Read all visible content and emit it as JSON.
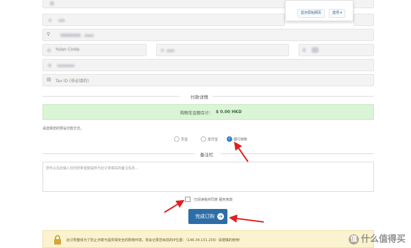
{
  "popup": {
    "show_all_button": "显示原始网页",
    "options_button": "选项",
    "options_caret": "▾"
  },
  "form": {
    "tax_id_placeholder": "Tax ID (非必填的)",
    "partial_company": "Yulan Cinda"
  },
  "payment": {
    "section_title": "付款详情",
    "cart_total_label": "购物车金额合计：",
    "cart_total_value": "$ 0.00 HKD",
    "choose_method_prompt": "请选择您的预设付款方式。",
    "methods": [
      {
        "label": "贝宝",
        "selected": false
      },
      {
        "label": "支付宝",
        "selected": false
      },
      {
        "label": "银行转账",
        "selected": true
      }
    ]
  },
  "notes": {
    "section_title": "备注栏",
    "placeholder": "您可以在此输入任何您希望能提供与此订单相关的备注信息..."
  },
  "terms": {
    "label": "已阅读我并同意 服务条款"
  },
  "submit": {
    "label": "完成订购",
    "icon": "➔"
  },
  "notice": {
    "text": "此订购整体为了防止诈欺与提供保安全的购物环境，将会记录您目前的IP位置：（146.34.131.239）请谨慎的使用!"
  },
  "watermark": {
    "text": "什么值得买",
    "logo_char": "值"
  },
  "colors": {
    "accent": "#2d6ea8",
    "success_bg": "#dbf3d7",
    "notice_bg": "#fbf3cf",
    "arrow": "#e02020"
  }
}
